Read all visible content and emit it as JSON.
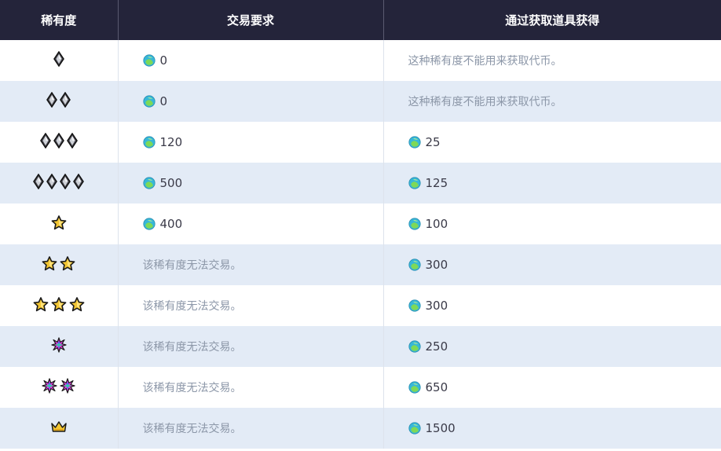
{
  "headers": {
    "rarity": "稀有度",
    "trade": "交易要求",
    "obtain": "通过获取道具获得"
  },
  "icons": {
    "diamond": "diamond-icon",
    "star": "star-icon",
    "shiny": "shiny-star-icon",
    "crown": "crown-icon",
    "coin": "flash-coin-icon"
  },
  "colors": {
    "header_bg": "#24243a",
    "row_alt": "#e3ebf6",
    "muted_text": "#8c97a8"
  },
  "rows": [
    {
      "rarity_type": "diamond",
      "rarity_count": 1,
      "trade": {
        "coin": true,
        "text": "0"
      },
      "obtain": {
        "coin": false,
        "text": "这种稀有度不能用来获取代币。"
      }
    },
    {
      "rarity_type": "diamond",
      "rarity_count": 2,
      "trade": {
        "coin": true,
        "text": "0"
      },
      "obtain": {
        "coin": false,
        "text": "这种稀有度不能用来获取代币。"
      }
    },
    {
      "rarity_type": "diamond",
      "rarity_count": 3,
      "trade": {
        "coin": true,
        "text": "120"
      },
      "obtain": {
        "coin": true,
        "text": "25"
      }
    },
    {
      "rarity_type": "diamond",
      "rarity_count": 4,
      "trade": {
        "coin": true,
        "text": "500"
      },
      "obtain": {
        "coin": true,
        "text": "125"
      }
    },
    {
      "rarity_type": "star",
      "rarity_count": 1,
      "trade": {
        "coin": true,
        "text": "400"
      },
      "obtain": {
        "coin": true,
        "text": "100"
      }
    },
    {
      "rarity_type": "star",
      "rarity_count": 2,
      "trade": {
        "coin": false,
        "text": "该稀有度无法交易。"
      },
      "obtain": {
        "coin": true,
        "text": "300"
      }
    },
    {
      "rarity_type": "star",
      "rarity_count": 3,
      "trade": {
        "coin": false,
        "text": "该稀有度无法交易。"
      },
      "obtain": {
        "coin": true,
        "text": "300"
      }
    },
    {
      "rarity_type": "shiny",
      "rarity_count": 1,
      "trade": {
        "coin": false,
        "text": "该稀有度无法交易。"
      },
      "obtain": {
        "coin": true,
        "text": "250"
      }
    },
    {
      "rarity_type": "shiny",
      "rarity_count": 2,
      "trade": {
        "coin": false,
        "text": "该稀有度无法交易。"
      },
      "obtain": {
        "coin": true,
        "text": "650"
      }
    },
    {
      "rarity_type": "crown",
      "rarity_count": 1,
      "trade": {
        "coin": false,
        "text": "该稀有度无法交易。"
      },
      "obtain": {
        "coin": true,
        "text": "1500"
      }
    }
  ]
}
